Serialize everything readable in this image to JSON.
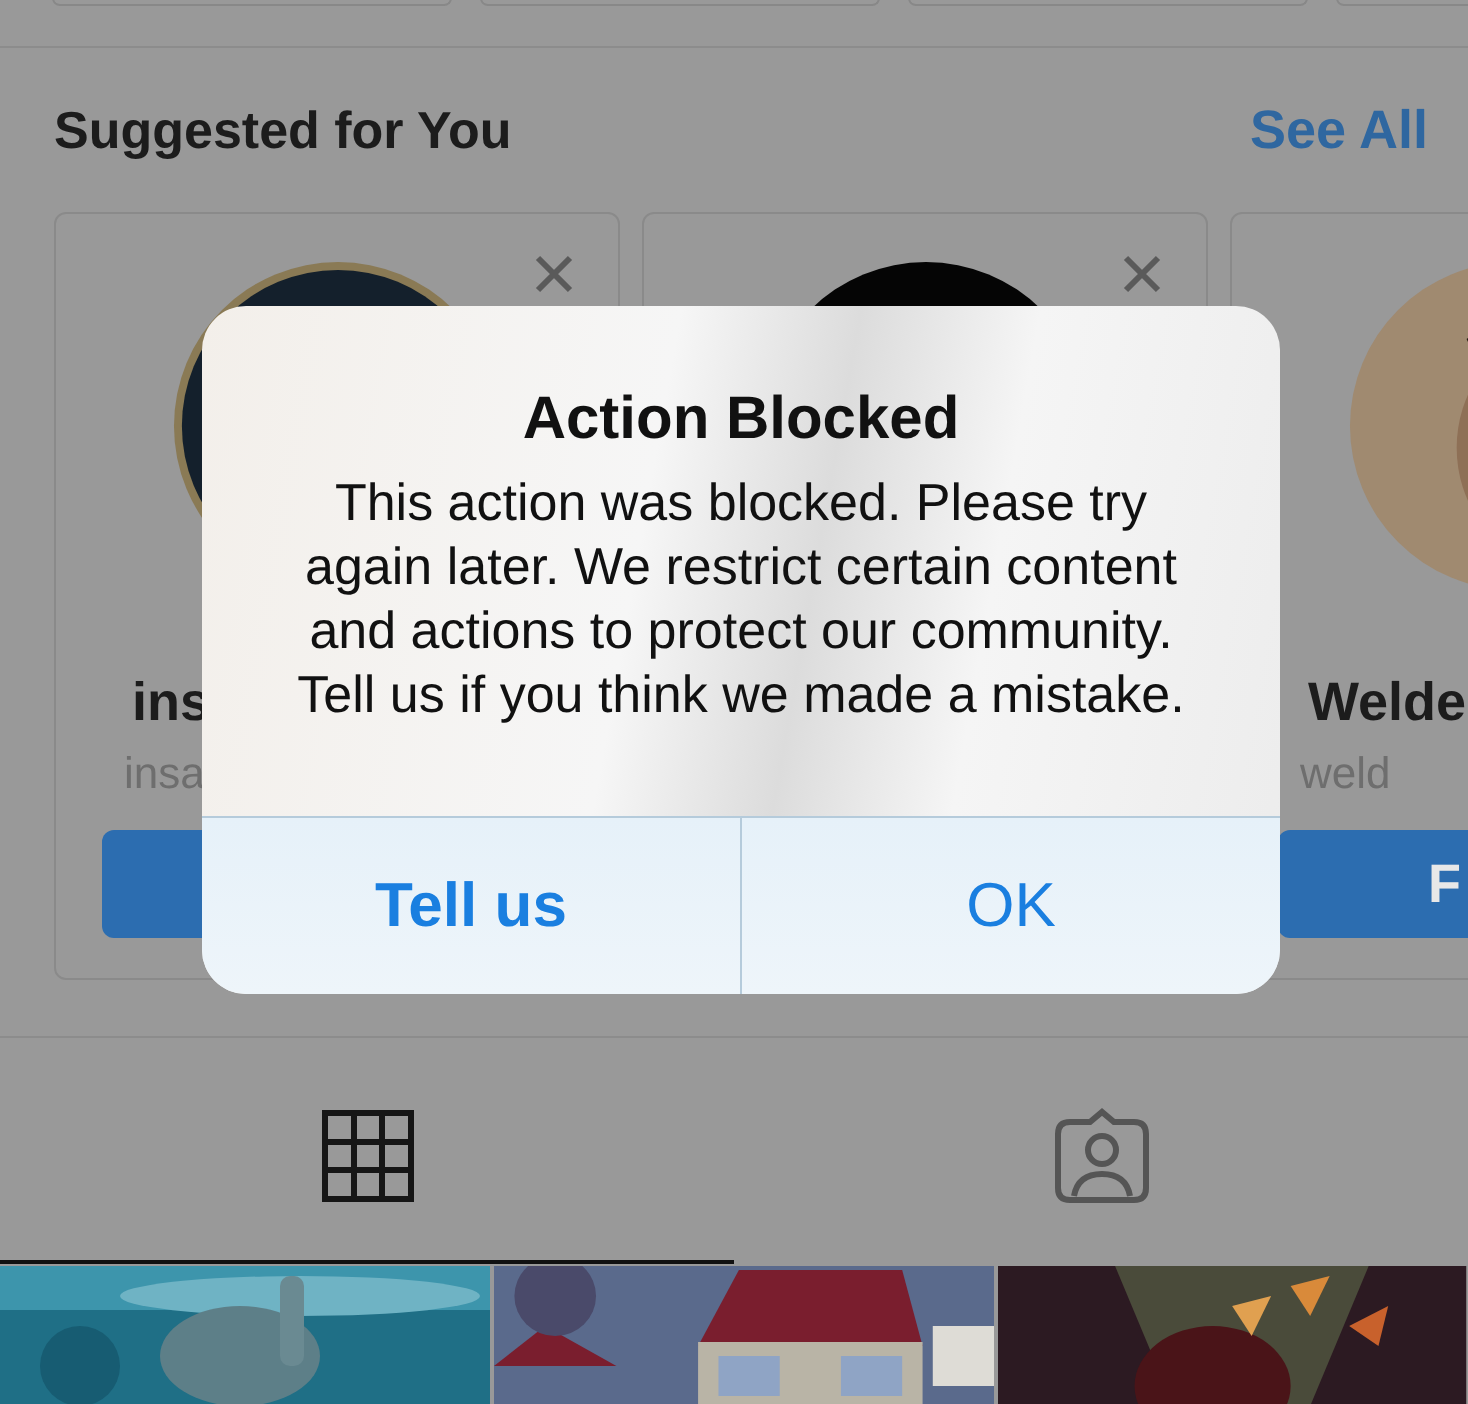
{
  "suggested": {
    "title": "Suggested for You",
    "link": "See All",
    "cards": [
      {
        "avatar": {
          "kind": "picture"
        },
        "name": "ins",
        "username": "insa"
      },
      {
        "avatar": {
          "kind": "picture"
        }
      },
      {
        "avatar": {
          "kind": "picture"
        },
        "name": "Welde",
        "username": "weld",
        "button": "F"
      }
    ]
  },
  "profile_tabs": [
    {
      "kind": "grid",
      "selected": true
    },
    {
      "kind": "tagged",
      "selected": false
    }
  ],
  "dialog": {
    "title": "Action Blocked",
    "message": "This action was blocked. Please try again later. We restrict certain content and actions to protect our community. Tell us if you think we made a mistake.",
    "buttons": [
      {
        "label": "Tell us",
        "bold": true
      },
      {
        "label": "OK",
        "bold": false
      }
    ]
  }
}
